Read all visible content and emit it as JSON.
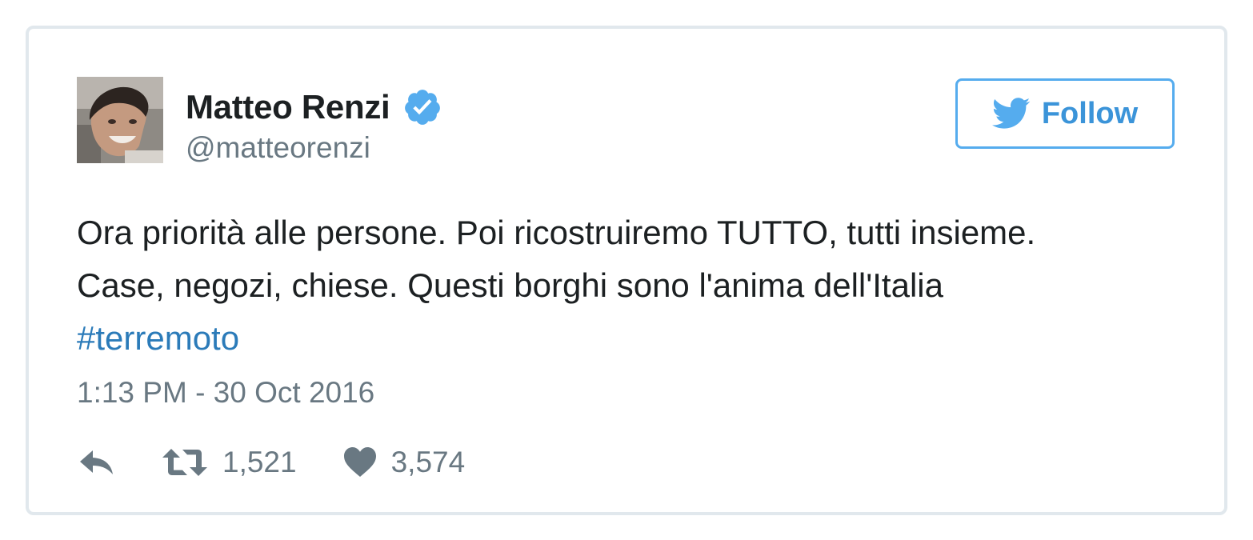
{
  "tweet": {
    "author": {
      "name": "Matteo Renzi",
      "handle": "@matteorenzi",
      "verified": true,
      "avatar_icon": "profile-photo"
    },
    "follow_button": {
      "label": "Follow",
      "icon": "twitter-bird-icon"
    },
    "text_lines": [
      "Ora priorità alle persone. Poi ricostruiremo TUTTO, tutti insieme.",
      "Case, negozi, chiese. Questi borghi sono l'anima dell'Italia"
    ],
    "hashtag": "#terremoto",
    "timestamp": "1:13 PM - 30 Oct 2016",
    "actions": {
      "reply_icon": "reply-icon",
      "retweet_icon": "retweet-icon",
      "retweet_count": "1,521",
      "like_icon": "heart-icon",
      "like_count": "3,574"
    }
  },
  "colors": {
    "border": "#e1e8ed",
    "name_text": "#1c2022",
    "secondary_text": "#697882",
    "link": "#2b7bb9",
    "follow_accent": "#55acee",
    "verified_badge": "#55acee"
  }
}
